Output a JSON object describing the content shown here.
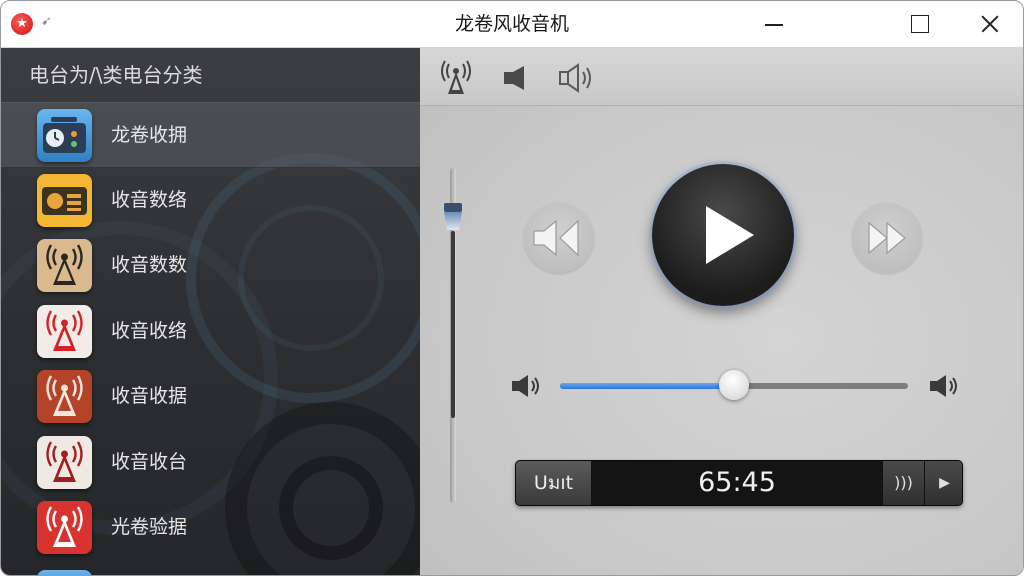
{
  "window": {
    "title": "龙卷风收音机",
    "icons": {
      "logo": "star-logo",
      "pin": "pin-icon",
      "minimize": "minimize-icon",
      "maximize": "maximize-icon",
      "close": "close-icon"
    }
  },
  "sidebar": {
    "header": "电台为/\\类电台分类",
    "items": [
      {
        "label": "龙卷收拥",
        "icon": "radio-clock-icon",
        "selected": true
      },
      {
        "label": "收音数络",
        "icon": "yellow-radio-icon",
        "selected": false
      },
      {
        "label": "收音数数",
        "icon": "antenna-beige-icon",
        "selected": false
      },
      {
        "label": "收音收络",
        "icon": "antenna-white-red-icon",
        "selected": false
      },
      {
        "label": "收音收据",
        "icon": "antenna-orange-icon",
        "selected": false
      },
      {
        "label": "收音收台",
        "icon": "antenna-white-dark-red-icon",
        "selected": false
      },
      {
        "label": "光卷验据",
        "icon": "antenna-red-icon",
        "selected": false
      }
    ]
  },
  "toolbar": {
    "icons": [
      "antenna-icon",
      "speaker-icon",
      "volume-outline-icon"
    ]
  },
  "player": {
    "vertical_slider_level": 0.85,
    "volume_level": 0.5,
    "unit_label": "Uมıt",
    "time": "65:45",
    "signal_label": ")))",
    "end_play_label": "▶",
    "colors": {
      "accent": "#2f74d8",
      "play_button": "#1c1c1c"
    }
  }
}
